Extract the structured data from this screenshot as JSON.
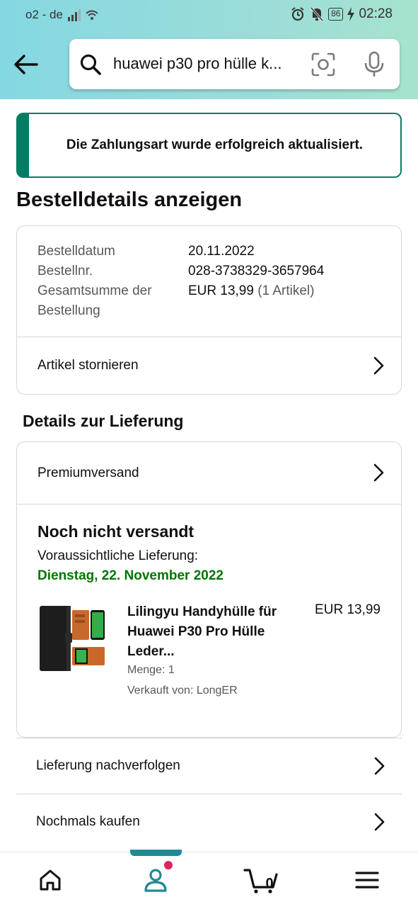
{
  "status_bar": {
    "carrier": "o2 - de",
    "battery": "86",
    "time": "02:28"
  },
  "search": {
    "query": "huawei p30 pro hülle k..."
  },
  "alert": {
    "message": "Die Zahlungsart wurde erfolgreich aktualisiert."
  },
  "page": {
    "title": "Bestelldetails anzeigen"
  },
  "order": {
    "date_label": "Bestelldatum",
    "date_value": "20.11.2022",
    "number_label": "Bestellnr.",
    "number_value": "028-3738329-3657964",
    "total_label_1": "Gesamtsumme der",
    "total_label_2": "Bestellung",
    "total_value": "EUR 13,99",
    "total_count": "(1 Artikel)",
    "cancel_label": "Artikel stornieren"
  },
  "delivery": {
    "section_title": "Details zur Lieferung",
    "shipping_option": "Premiumversand",
    "status_title": "Noch nicht versandt",
    "estimate_label": "Voraussichtliche Lieferung:",
    "estimate_date": "Dienstag, 22. November 2022",
    "product": {
      "title": "Lilingyu Handyhülle für Huawei P30 Pro Hülle Leder...",
      "price": "EUR 13,99",
      "quantity": "Menge: 1",
      "seller": "Verkauft von: LongER"
    }
  },
  "actions": {
    "track": "Lieferung nachverfolgen",
    "buy_again": "Nochmals kaufen"
  },
  "bottom_nav": {
    "cart_count": "0"
  },
  "colors": {
    "accent_teal": "#067d62",
    "delivery_green": "#007600",
    "nav_active": "#1f8a94"
  }
}
